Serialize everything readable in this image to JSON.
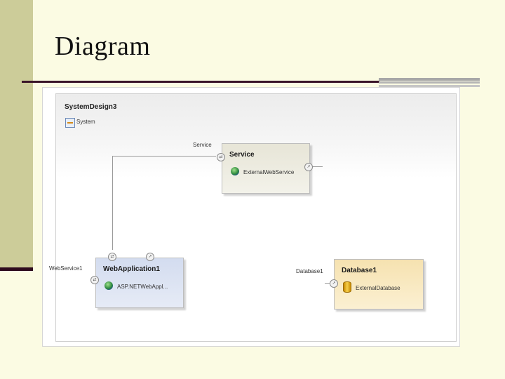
{
  "slide": {
    "title": "Diagram"
  },
  "diagram": {
    "system_name": "SystemDesign3",
    "system_label": "System",
    "service": {
      "title": "Service",
      "item": "ExternalWebService",
      "port_label": "Service"
    },
    "web_app": {
      "title": "WebApplication1",
      "item": "ASP.NETWebAppl...",
      "port_label": "WebService1"
    },
    "database": {
      "title": "Database1",
      "item": "ExternalDatabase",
      "port_label": "Database1"
    }
  }
}
